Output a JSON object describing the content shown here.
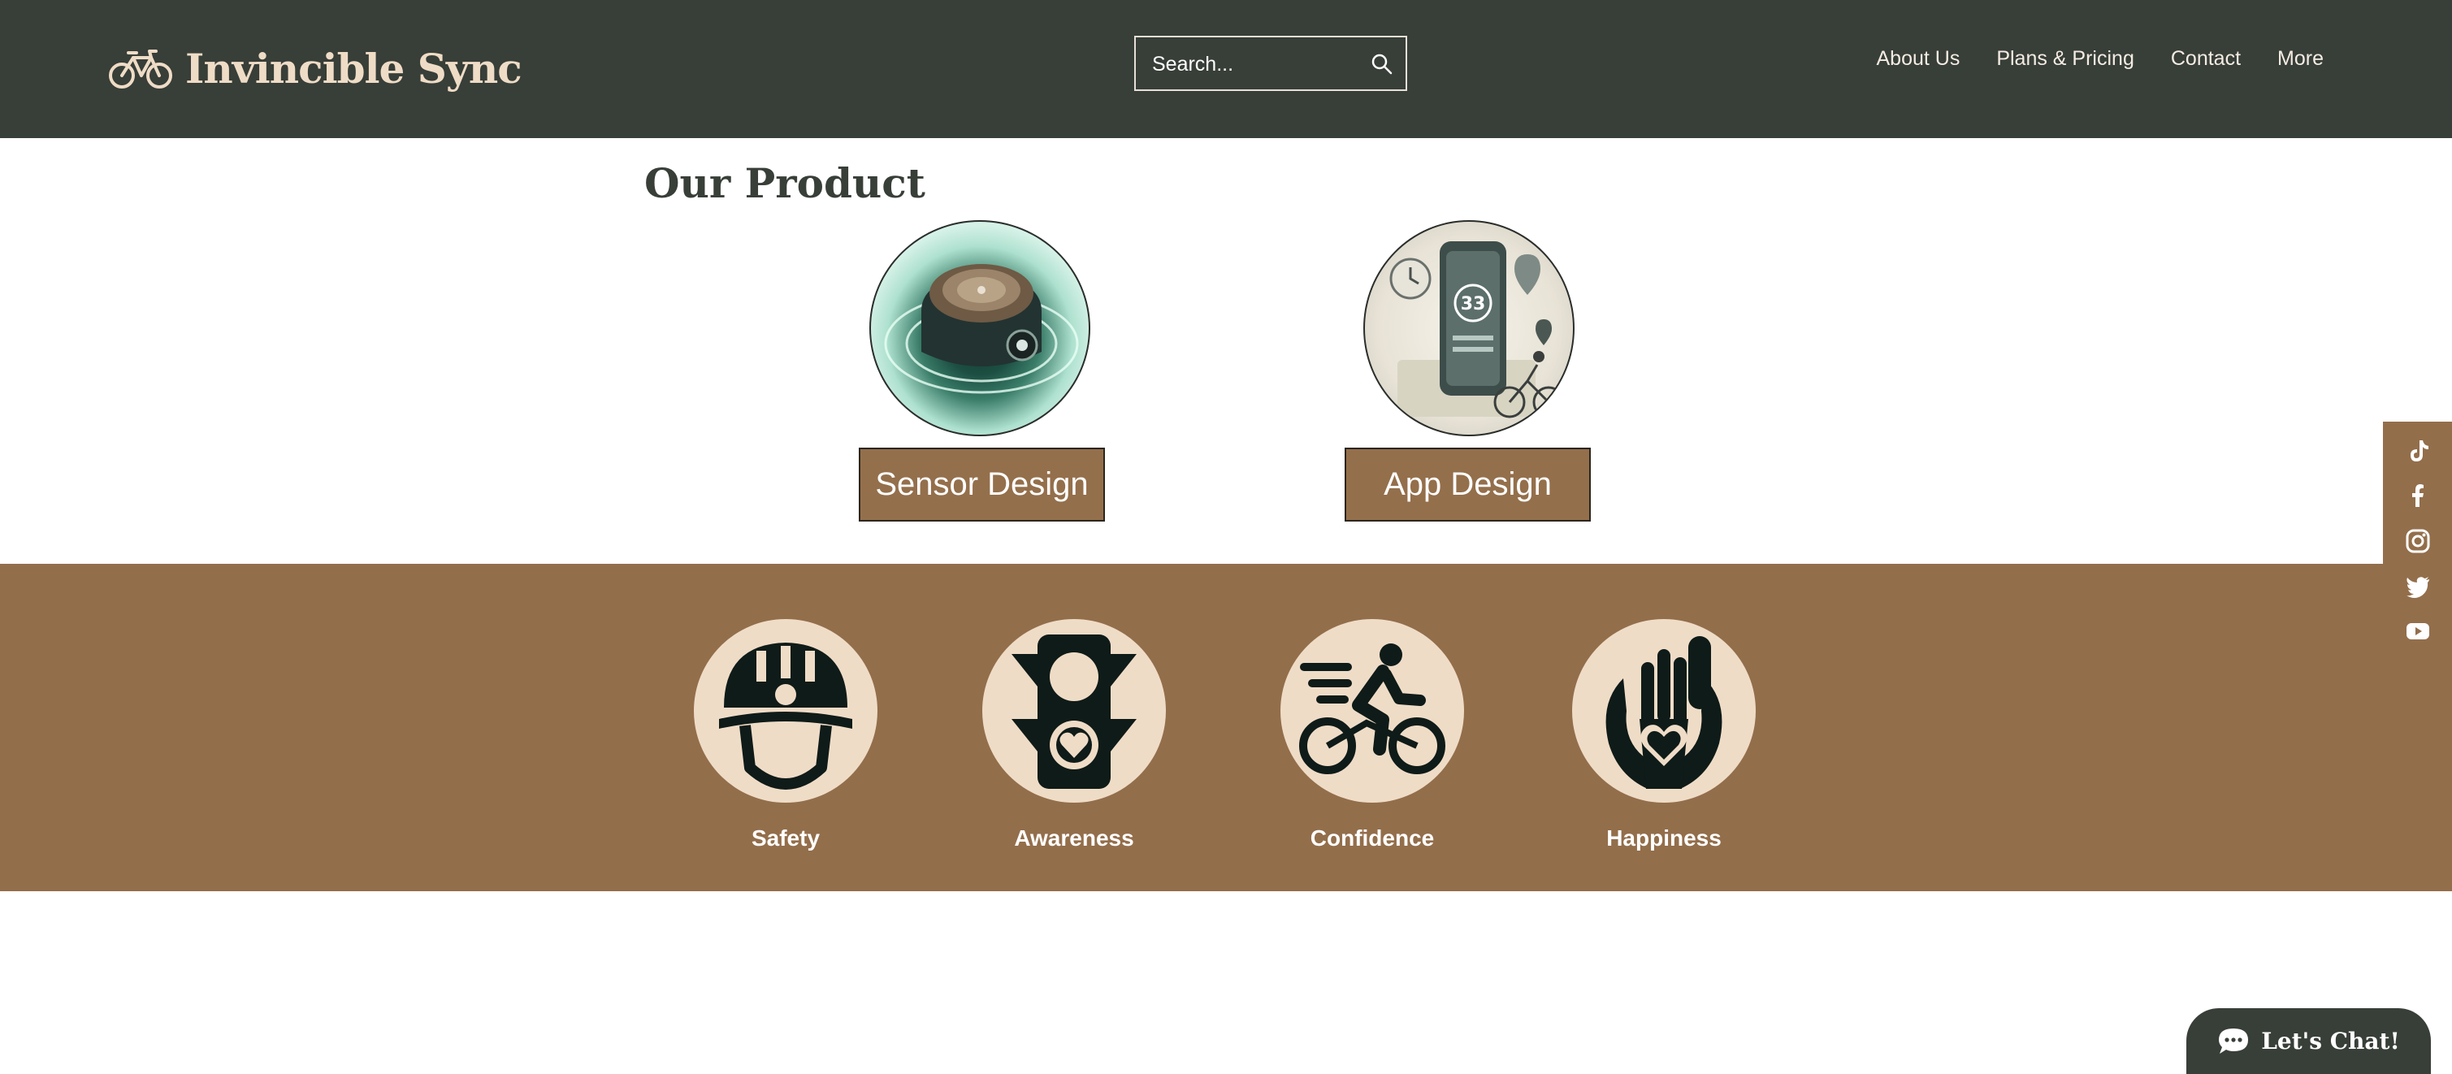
{
  "brand": {
    "name": "Invincible Sync",
    "icon": "bicycle-icon"
  },
  "search": {
    "placeholder": "Search...",
    "icon": "search-icon"
  },
  "nav": {
    "items": [
      "About Us",
      "Plans & Pricing",
      "Contact",
      "More"
    ]
  },
  "products": {
    "title": "Our Product",
    "items": [
      {
        "button": "Sensor Design",
        "image": "sensor-device-image"
      },
      {
        "button": "App Design",
        "image": "cycling-app-image"
      }
    ]
  },
  "values": [
    {
      "label": "Safety",
      "icon": "helmet-icon"
    },
    {
      "label": "Awareness",
      "icon": "traffic-light-heart-icon"
    },
    {
      "label": "Confidence",
      "icon": "cyclist-icon"
    },
    {
      "label": "Happiness",
      "icon": "hands-heart-icon"
    }
  ],
  "social": [
    "tiktok-icon",
    "facebook-icon",
    "instagram-icon",
    "twitter-icon",
    "youtube-icon"
  ],
  "chat": {
    "label": "Let's Chat!",
    "icon": "chat-bubble-icon"
  },
  "colors": {
    "header": "#383e38",
    "accent_brown": "#936e4b",
    "cream": "#efdcc7",
    "brand_text": "#efdcc6"
  }
}
